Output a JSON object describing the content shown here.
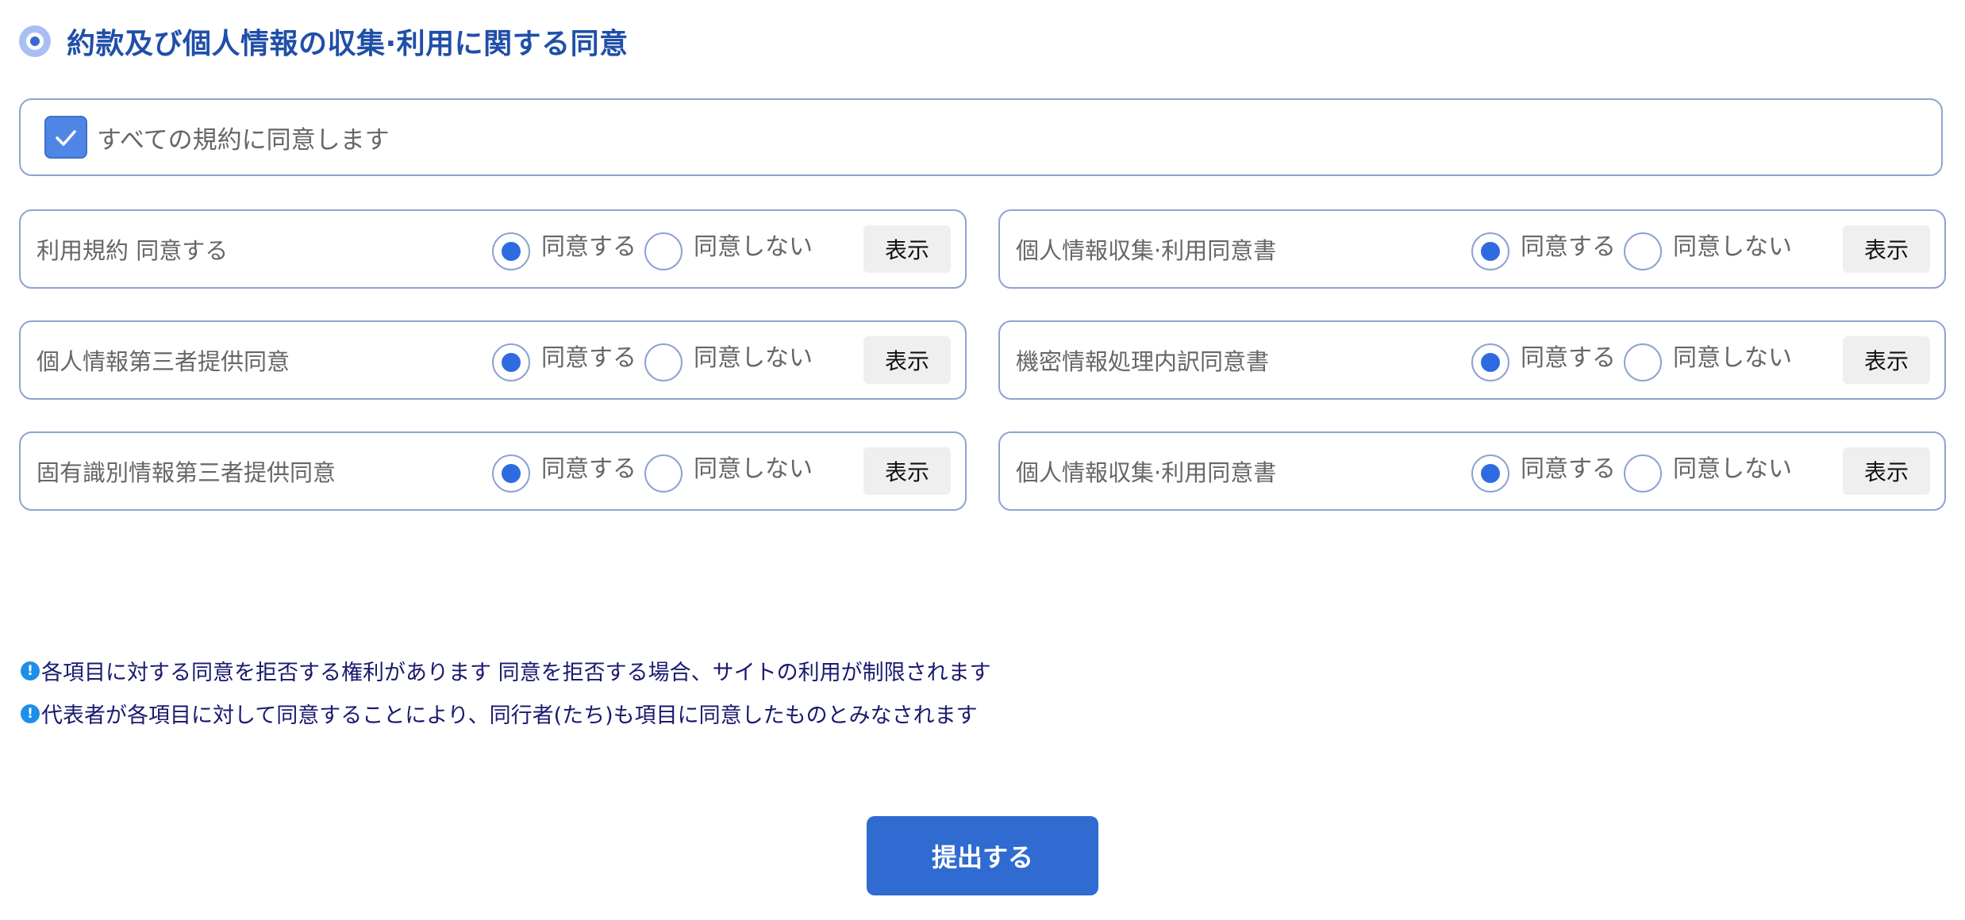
{
  "section": {
    "title": "約款及び個人情報の収集·利用に関する同意"
  },
  "agree_all": {
    "label": "すべての規約に同意します",
    "checked": true
  },
  "terms": [
    {
      "title": "利用規約 同意する",
      "yes_label": "同意する",
      "no_label": "同意しない",
      "view_label": "表示",
      "selected": "yes"
    },
    {
      "title": "個人情報収集·利用同意書",
      "yes_label": "同意する",
      "no_label": "同意しない",
      "view_label": "表示",
      "selected": "yes"
    },
    {
      "title": "個人情報第三者提供同意",
      "yes_label": "同意する",
      "no_label": "同意しない",
      "view_label": "表示",
      "selected": "yes"
    },
    {
      "title": "機密情報処理内訳同意書",
      "yes_label": "同意する",
      "no_label": "同意しない",
      "view_label": "表示",
      "selected": "yes"
    },
    {
      "title": "固有識別情報第三者提供同意",
      "yes_label": "同意する",
      "no_label": "同意しない",
      "view_label": "表示",
      "selected": "yes"
    },
    {
      "title": "個人情報収集·利用同意書",
      "yes_label": "同意する",
      "no_label": "同意しない",
      "view_label": "表示",
      "selected": "yes"
    }
  ],
  "notices": [
    {
      "icon": "!",
      "text": "各項目に対する同意を拒否する権利があります 同意を拒否する場合、サイトの利用が制限されます"
    },
    {
      "icon": "!",
      "text": "代表者が各項目に対して同意することにより、同行者(たち)も項目に同意したものとみなされます"
    }
  ],
  "submit": {
    "label": "提出する"
  },
  "colors": {
    "accent": "#2f6bd0",
    "title": "#1f4fa8",
    "border": "#8ea3d0",
    "notice_text": "#1a1a6e",
    "notice_icon": "#1d8fe8"
  }
}
